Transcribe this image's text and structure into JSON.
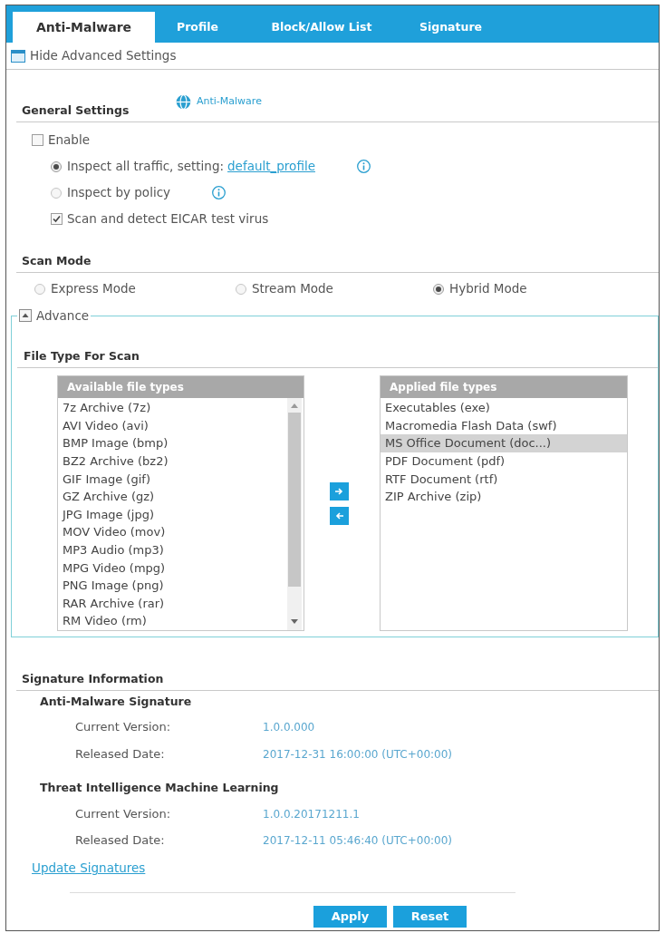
{
  "tabs": [
    {
      "label": "Anti-Malware",
      "selected": true
    },
    {
      "label": "Profile",
      "selected": false
    },
    {
      "label": "Block/Allow List",
      "selected": false
    },
    {
      "label": "Signature",
      "selected": false
    }
  ],
  "advanced_toggle": {
    "label": "Hide Advanced Settings"
  },
  "general_settings": {
    "title": "General Settings",
    "help_link": "Anti-Malware",
    "enable": {
      "label": "Enable",
      "checked": false
    },
    "inspection_options": [
      {
        "label": "Inspect all traffic, setting:",
        "link": "default_profile",
        "selected": true
      },
      {
        "label": "Inspect by policy",
        "selected": false
      }
    ],
    "eicar": {
      "label": "Scan and detect EICAR test virus",
      "checked": true
    }
  },
  "scan_mode": {
    "title": "Scan Mode",
    "options": [
      {
        "label": "Express Mode",
        "selected": false
      },
      {
        "label": "Stream Mode",
        "selected": false
      },
      {
        "label": "Hybrid Mode",
        "selected": true
      }
    ]
  },
  "advance": {
    "legend": "Advance",
    "expanded": true,
    "file_type_for_scan": {
      "title": "File Type For Scan",
      "available": {
        "header": "Available file types",
        "items": [
          {
            "label": "7z Archive (7z)",
            "selected": false
          },
          {
            "label": "AVI Video (avi)",
            "selected": false
          },
          {
            "label": "BMP Image (bmp)",
            "selected": false
          },
          {
            "label": "BZ2 Archive (bz2)",
            "selected": false
          },
          {
            "label": "GIF Image (gif)",
            "selected": false
          },
          {
            "label": "GZ Archive (gz)",
            "selected": false
          },
          {
            "label": "JPG Image (jpg)",
            "selected": false
          },
          {
            "label": "MOV Video (mov)",
            "selected": false
          },
          {
            "label": "MP3 Audio (mp3)",
            "selected": false
          },
          {
            "label": "MPG Video (mpg)",
            "selected": false
          },
          {
            "label": "PNG Image (png)",
            "selected": false
          },
          {
            "label": "RAR Archive (rar)",
            "selected": false
          },
          {
            "label": "RM Video (rm)",
            "selected": false
          }
        ]
      },
      "applied": {
        "header": "Applied file types",
        "items": [
          {
            "label": "Executables (exe)",
            "selected": false
          },
          {
            "label": "Macromedia Flash Data (swf)",
            "selected": false
          },
          {
            "label": "MS Office Document (doc...)",
            "selected": true
          },
          {
            "label": "PDF Document (pdf)",
            "selected": false
          },
          {
            "label": "RTF Document (rtf)",
            "selected": false
          },
          {
            "label": "ZIP Archive (zip)",
            "selected": false
          }
        ]
      }
    }
  },
  "signature_information": {
    "title": "Signature Information",
    "groups": [
      {
        "title": "Anti-Malware Signature",
        "rows": [
          {
            "label": "Current Version:",
            "value": "1.0.0.000"
          },
          {
            "label": "Released Date:",
            "value": "2017-12-31 16:00:00 (UTC+00:00)"
          }
        ]
      },
      {
        "title": "Threat Intelligence Machine Learning",
        "rows": [
          {
            "label": "Current Version:",
            "value": "1.0.0.20171211.1"
          },
          {
            "label": "Released Date:",
            "value": "2017-12-11 05:46:40 (UTC+00:00)"
          }
        ]
      }
    ],
    "update_link": "Update Signatures"
  },
  "buttons": [
    "Apply",
    "Reset"
  ]
}
